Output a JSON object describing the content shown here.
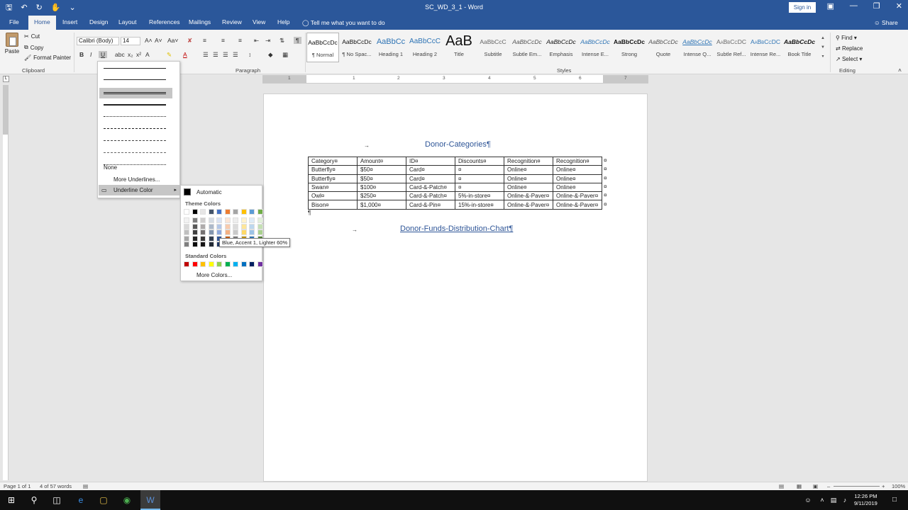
{
  "titlebar": {
    "document_title": "SC_WD_3_1 - Word",
    "signin_label": "Sign in",
    "qat_icons": [
      "save-icon",
      "undo-icon",
      "redo-icon",
      "touch-mode-icon",
      "customize-qat-icon"
    ]
  },
  "tabs": [
    "File",
    "Home",
    "Insert",
    "Design",
    "Layout",
    "References",
    "Mailings",
    "Review",
    "View",
    "Help"
  ],
  "tellme": "Tell me what you want to do",
  "share": "Share",
  "clipboard": {
    "paste": "Paste",
    "cut": "Cut",
    "copy": "Copy",
    "format_painter": "Format Painter",
    "group_label": "Clipboard"
  },
  "font": {
    "name": "Calibri (Body)",
    "size": "14",
    "bold": "B",
    "italic": "I",
    "underline": "U"
  },
  "paragraph": {
    "group_label": "Paragraph"
  },
  "styles": {
    "group_label": "Styles",
    "items": [
      {
        "preview": "AaBbCcDc",
        "name": "¶ Normal"
      },
      {
        "preview": "AaBbCcDc",
        "name": "¶ No Spac..."
      },
      {
        "preview": "AaBbCc",
        "name": "Heading 1"
      },
      {
        "preview": "AaBbCcC",
        "name": "Heading 2"
      },
      {
        "preview": "AaB",
        "name": "Title"
      },
      {
        "preview": "AaBbCcC",
        "name": "Subtitle"
      },
      {
        "preview": "AaBbCcDc",
        "name": "Subtle Em..."
      },
      {
        "preview": "AaBbCcDc",
        "name": "Emphasis"
      },
      {
        "preview": "AaBbCcDc",
        "name": "Intense E..."
      },
      {
        "preview": "AaBbCcDc",
        "name": "Strong"
      },
      {
        "preview": "AaBbCcDc",
        "name": "Quote"
      },
      {
        "preview": "AaBbCcDc",
        "name": "Intense Q..."
      },
      {
        "preview": "AaBbCcDC",
        "name": "Subtle Ref..."
      },
      {
        "preview": "AaBbCcDC",
        "name": "Intense Re..."
      },
      {
        "preview": "AaBbCcDc",
        "name": "Book Title"
      }
    ]
  },
  "editing": {
    "find": "Find",
    "replace": "Replace",
    "select": "Select",
    "group_label": "Editing"
  },
  "ruler_numbers": [
    "1",
    "1",
    "2",
    "3",
    "4",
    "5",
    "6",
    "7"
  ],
  "document": {
    "heading1": "Donor-Categories¶",
    "heading2": "Donor-Funds-Distribution-Chart¶",
    "pilcrow": "¶",
    "table": [
      [
        "Category¤",
        "Amount¤",
        "ID¤",
        "Discounts¤",
        "Recognition¤",
        "Recognition¤"
      ],
      [
        "Butterfly¤",
        "$50¤",
        "Card¤",
        "¤",
        "Online¤",
        "Online¤"
      ],
      [
        "Butterfly¤",
        "$50¤",
        "Card¤",
        "¤",
        "Online¤",
        "Online¤"
      ],
      [
        "Swan¤",
        "$100¤",
        "Card-&-Patch¤",
        "¤",
        "Online¤",
        "Online¤"
      ],
      [
        "Owl¤",
        "$250¤",
        "Card-&-Patch¤",
        "5%-in-store¤",
        "Online-&-Paver¤",
        "Online-&-Paver¤"
      ],
      [
        "Bison¤",
        "$1,000¤",
        "Card-&-Pin¤",
        "15%-in-store¤",
        "Online-&-Paver¤",
        "Online-&-Paver¤"
      ]
    ],
    "row_end": "¤"
  },
  "underline_menu": {
    "none": "None",
    "more": "More Underlines...",
    "color": "Underline Color"
  },
  "color_menu": {
    "automatic": "Automatic",
    "theme_label": "Theme Colors",
    "standard_label": "Standard Colors",
    "more": "More Colors...",
    "tooltip": "Blue, Accent 1, Lighter 60%",
    "theme_top": [
      "#ffffff",
      "#000000",
      "#e7e6e6",
      "#44546a",
      "#4472c4",
      "#ed7d31",
      "#a5a5a5",
      "#ffc000",
      "#5b9bd5",
      "#70ad47"
    ],
    "theme_shades": [
      [
        "#f2f2f2",
        "#7f7f7f",
        "#d0cece",
        "#d6dce4",
        "#dae3f3",
        "#fbe5d6",
        "#ededed",
        "#fff2cc",
        "#deebf7",
        "#e2f0d9"
      ],
      [
        "#d9d9d9",
        "#595959",
        "#aeabab",
        "#adb9ca",
        "#b4c7e7",
        "#f8cbad",
        "#dbdbdb",
        "#ffe699",
        "#bdd7ee",
        "#c5e0b4"
      ],
      [
        "#bfbfbf",
        "#404040",
        "#757171",
        "#8497b0",
        "#8faadc",
        "#f4b183",
        "#c9c9c9",
        "#ffd966",
        "#9dc3e6",
        "#a9d18e"
      ],
      [
        "#a6a6a6",
        "#262626",
        "#3a3838",
        "#333f50",
        "#2f5597",
        "#c55a11",
        "#7b7b7b",
        "#bf9000",
        "#2e75b6",
        "#548235"
      ],
      [
        "#7f7f7f",
        "#0d0d0d",
        "#171616",
        "#222a35",
        "#203864",
        "#843c0c",
        "#525252",
        "#7f6000",
        "#1f4e79",
        "#385723"
      ]
    ],
    "standard": [
      "#c00000",
      "#ff0000",
      "#ffc000",
      "#ffff00",
      "#92d050",
      "#00b050",
      "#00b0f0",
      "#0070c0",
      "#002060",
      "#7030a0"
    ]
  },
  "status": {
    "page": "Page 1 of 1",
    "words": "4 of 57 words",
    "zoom": "100%"
  },
  "taskbar": {
    "time": "12:26 PM",
    "date": "9/11/2019"
  },
  "colors": {
    "accent": "#2b579a",
    "heading": "#2e5597"
  }
}
